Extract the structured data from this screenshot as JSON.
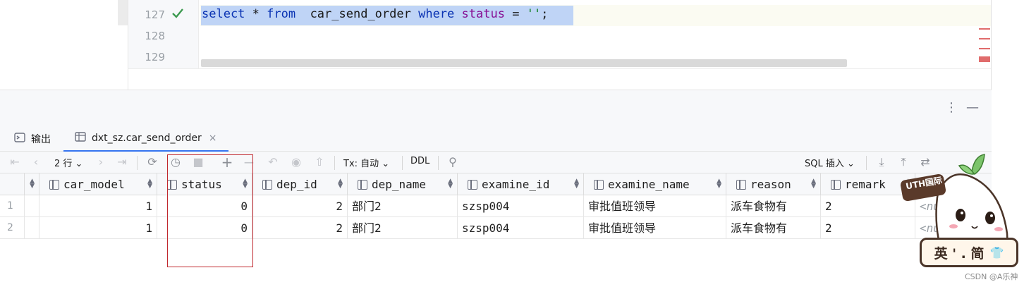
{
  "editor": {
    "lines": [
      {
        "number": "127",
        "status": "ok",
        "tokens": [
          {
            "t": "select",
            "c": "kw"
          },
          {
            "t": " * ",
            "c": ""
          },
          {
            "t": "from",
            "c": "kw"
          },
          {
            "t": "  car_send_order ",
            "c": ""
          },
          {
            "t": "where",
            "c": "kw"
          },
          {
            "t": " ",
            "c": ""
          },
          {
            "t": "status",
            "c": "fld"
          },
          {
            "t": " = ",
            "c": ""
          },
          {
            "t": "''",
            "c": "str"
          },
          {
            "t": ";",
            "c": ""
          }
        ]
      },
      {
        "number": "128"
      },
      {
        "number": "129"
      }
    ],
    "check_icon": "check-icon"
  },
  "tabs": [
    {
      "label": "输出",
      "icon": "output-icon"
    },
    {
      "label": "dxt_sz.car_send_order",
      "icon": "table-icon",
      "close": "×"
    }
  ],
  "toolbar": {
    "rows_label": "2 行",
    "tx_label": "Tx: 自动",
    "ddl_label": "DDL",
    "sql_insert_label": "SQL 插入"
  },
  "grid": {
    "columns": [
      "car_model",
      "status",
      "dep_id",
      "dep_name",
      "examine_id",
      "examine_name",
      "reason",
      "remark"
    ],
    "rows": [
      {
        "n": "1",
        "car_model": "1",
        "status": "0",
        "dep_id": "2",
        "dep_name": "部门2",
        "examine_id": "szsp004",
        "examine_name": "审批值班领导",
        "reason": "派车食物有",
        "remark": "2",
        "next": "<nu"
      },
      {
        "n": "2",
        "car_model": "1",
        "status": "0",
        "dep_id": "2",
        "dep_name": "部门2",
        "examine_id": "szsp004",
        "examine_name": "审批值班领导",
        "reason": "派车食物有",
        "remark": "2",
        "next": "<nu"
      }
    ]
  },
  "overlay": {
    "badge": "UTH国际",
    "sign": "英 ' . 简",
    "watermark": "CSDN @A乐神"
  },
  "colors": {
    "accent": "#3574f0",
    "keyword": "#0a33b3",
    "highlight_box": "#c0282e"
  }
}
